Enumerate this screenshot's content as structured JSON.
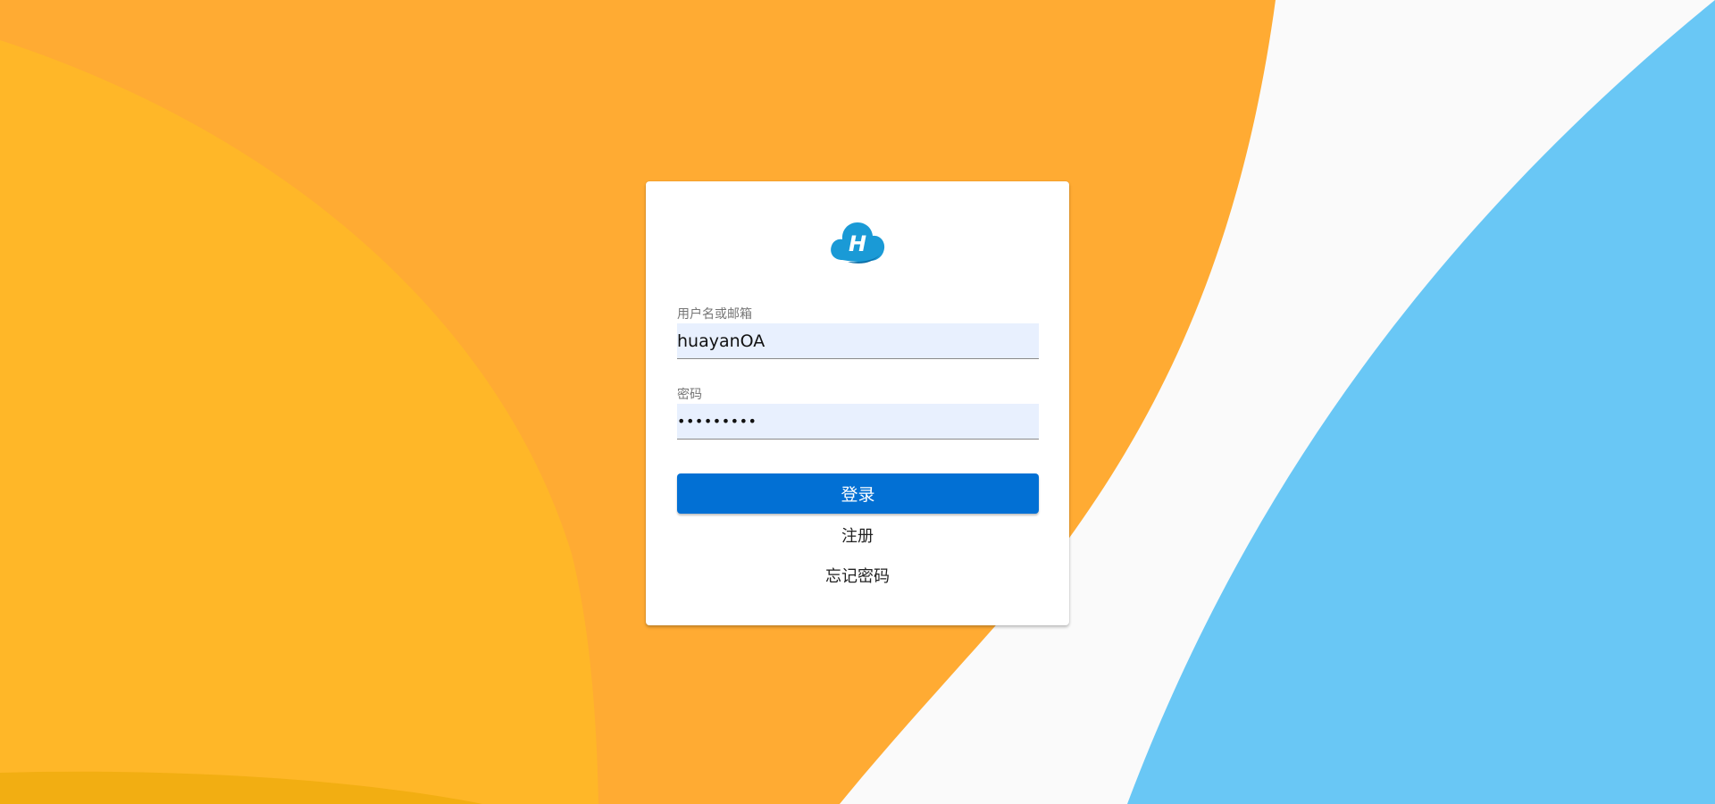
{
  "login_form": {
    "username": {
      "label": "用户名或邮箱",
      "value": "huayanOA"
    },
    "password": {
      "label": "密码",
      "value": "huayanOA1"
    },
    "login_label": "登录",
    "register_label": "注册",
    "forgot_label": "忘记密码"
  },
  "logo": {
    "icon": "cloud-h-logo",
    "letter": "H",
    "color": "#1a9ad6"
  },
  "colors": {
    "orange": "#ffab33",
    "yellow": "#ffb728",
    "blue": "#69c7f5",
    "primary": "#0270d4",
    "input_bg": "#e8f0fe"
  }
}
